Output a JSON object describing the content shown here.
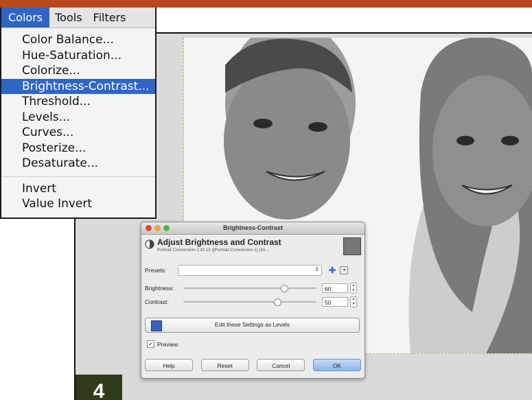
{
  "menu": {
    "bar": [
      "Colors",
      "Tools",
      "Filters"
    ],
    "items": [
      "Color Balance...",
      "Hue-Saturation...",
      "Colorize...",
      "Brightness-Contrast...",
      "Threshold...",
      "Levels...",
      "Curves...",
      "Posterize...",
      "Desaturate..."
    ],
    "items2": [
      "Invert",
      "Value Invert"
    ]
  },
  "dialog": {
    "title": "Brightness-Contrast",
    "header_title": "Adjust Brightness and Contrast",
    "header_sub": "Portrait Conversion-1.tif-13 ([Portrait Conversion-1] (im...",
    "presets_label": "Presets:",
    "brightness_label": "Brightness:",
    "brightness_value": "60",
    "contrast_label": "Contrast:",
    "contrast_value": "50",
    "levels_button": "Edit these Settings as Levels",
    "preview_label": "Preview",
    "buttons": [
      "Help",
      "Reset",
      "Cancel",
      "OK"
    ]
  },
  "badge": "4",
  "colors": {
    "topbar": "#b64a1f",
    "menu_highlight": "#2f66c6",
    "badge": "#2f3a1a"
  },
  "icons": [
    "brightness-contrast-icon",
    "add-preset-icon",
    "options-icon",
    "levels-icon",
    "checkbox-icon"
  ]
}
